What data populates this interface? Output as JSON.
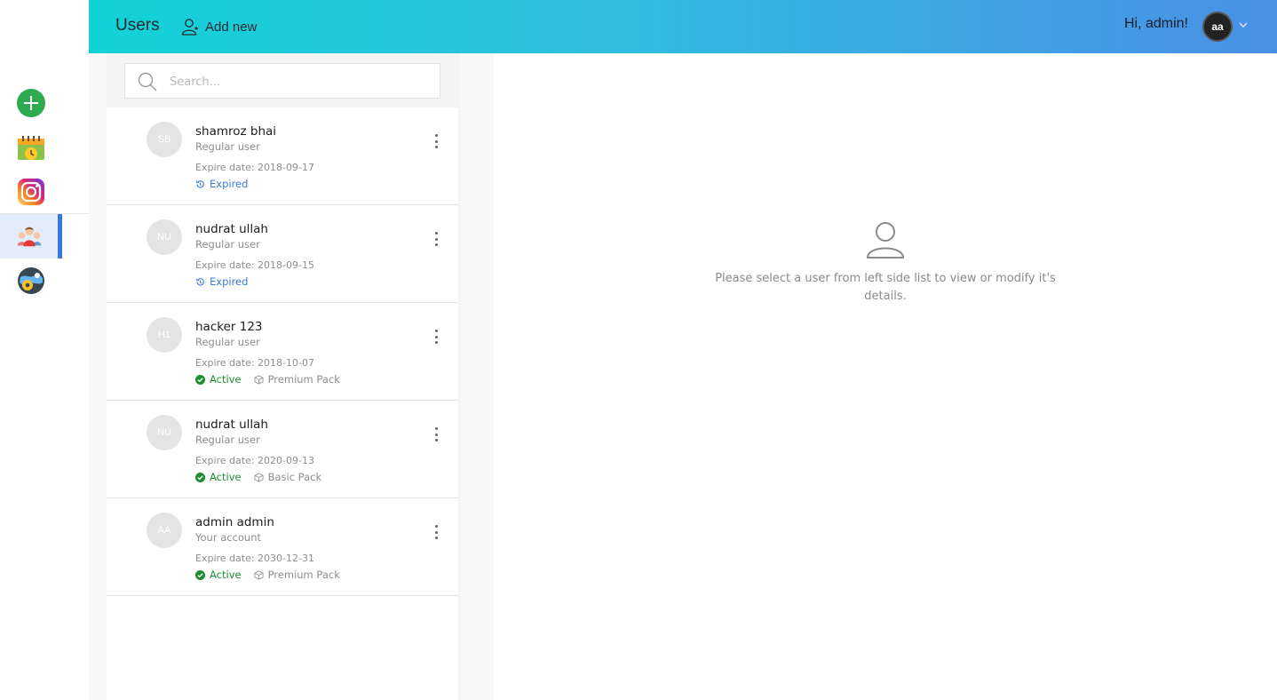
{
  "header": {
    "title": "Users",
    "add_new_label": "Add new",
    "greeting": "Hi, admin!",
    "avatar_initials": "aa",
    "gradient": [
      "#12d2d6",
      "#4a8fe6"
    ]
  },
  "sidebar": {
    "items": [
      {
        "icon": "add-circle-icon",
        "active": false
      },
      {
        "icon": "calendar-clock-icon",
        "active": false
      },
      {
        "icon": "instagram-icon",
        "active": false
      },
      {
        "icon": "users-group-icon",
        "active": true
      },
      {
        "icon": "settings-globe-icon",
        "active": false
      }
    ],
    "active_color": "#3b76e1"
  },
  "search": {
    "placeholder": "Search..."
  },
  "users": [
    {
      "initials": "SB",
      "name": "shamroz bhai",
      "role": "Regular user",
      "expire": "Expire date: 2018-09-17",
      "status": "Expired",
      "status_type": "expired",
      "pack": ""
    },
    {
      "initials": "NU",
      "name": "nudrat ullah",
      "role": "Regular user",
      "expire": "Expire date: 2018-09-15",
      "status": "Expired",
      "status_type": "expired",
      "pack": ""
    },
    {
      "initials": "H1",
      "name": "hacker 123",
      "role": "Regular user",
      "expire": "Expire date: 2018-10-07",
      "status": "Active",
      "status_type": "active",
      "pack": "Premium Pack"
    },
    {
      "initials": "NU",
      "name": "nudrat ullah",
      "role": "Regular user",
      "expire": "Expire date: 2020-09-13",
      "status": "Active",
      "status_type": "active",
      "pack": "Basic Pack"
    },
    {
      "initials": "AA",
      "name": "admin admin",
      "role": "Your account",
      "expire": "Expire date: 2030-12-31",
      "status": "Active",
      "status_type": "active",
      "pack": "Premium Pack"
    }
  ],
  "status_colors": {
    "expired": "#3b7dd8",
    "active": "#1e8e2e"
  },
  "detail": {
    "empty_message": "Please select a user from left side list to view or modify it's details."
  }
}
